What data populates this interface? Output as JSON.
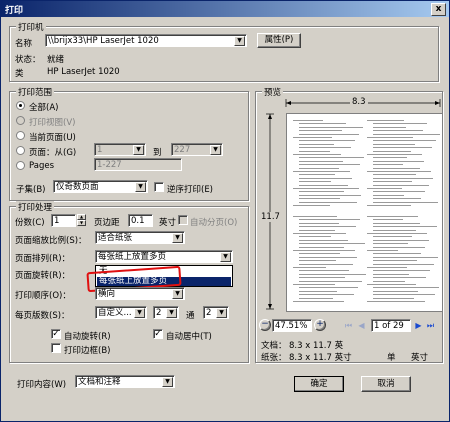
{
  "window": {
    "title": "打印",
    "close_glyph": "x"
  },
  "printer": {
    "group_label": "打印机",
    "name_label": "名称",
    "name_value": "\\\\brijx33\\HP LaserJet 1020",
    "properties_button": "属性(P)",
    "status_label": "状态：",
    "status_value": "就绪",
    "type_label": "类",
    "type_value": "HP LaserJet 1020"
  },
  "range": {
    "group_label": "打印范围",
    "all": "全部(A)",
    "view": "打印视图(V)",
    "current_page": "当前页面(U)",
    "pages_from": "页面：从(G)",
    "from_value": "1",
    "to_label": "到",
    "to_value": "227",
    "pages_label": "Pages",
    "pages_value": "1-227",
    "subset_label": "子集(B)",
    "subset_value": "仅奇数页面",
    "reverse_label": "逆序打印(E)"
  },
  "handling": {
    "group_label": "打印处理",
    "copies_label": "份数(C)",
    "copies_value": "1",
    "margin_label": "页边距",
    "margin_value": "0.1",
    "unit_label": "英寸",
    "collate_label": "自动分页(O)",
    "scaling_label": "页面缩放比例(S)：",
    "scaling_value": "适合纸张",
    "arrange_label": "页面排列(R)：",
    "arrange_value": "每张纸上放置多页",
    "rotate_label": "页面旋转(R)：",
    "dropdown_options": [
      "无",
      "每张纸上放置多页"
    ],
    "order_label": "打印顺序(O)：",
    "order_value": "横向",
    "per_sheet_label": "每页版数(S)：",
    "per_sheet_value": "自定义...",
    "cols_value": "2",
    "by_label": "通",
    "rows_value": "2",
    "auto_rotate": "自动旋转(R)",
    "auto_center": "自动居中(T)",
    "print_border": "打印边框(B)"
  },
  "preview": {
    "group_label": "预览",
    "width_label": "8.3",
    "height_label": "11.7",
    "zoom_value": "47.51%",
    "page_indicator": "1 of 29",
    "doc_label": "文档：",
    "doc_value": "8.3 x 11.7 英",
    "paper_label": "纸张：",
    "paper_value": "8.3 x 11.7 英寸",
    "unit_label": "单",
    "unit_value": "英寸"
  },
  "content": {
    "label": "打印内容(W)",
    "value": "文档和注释"
  },
  "buttons": {
    "ok": "确定",
    "cancel": "取消"
  }
}
